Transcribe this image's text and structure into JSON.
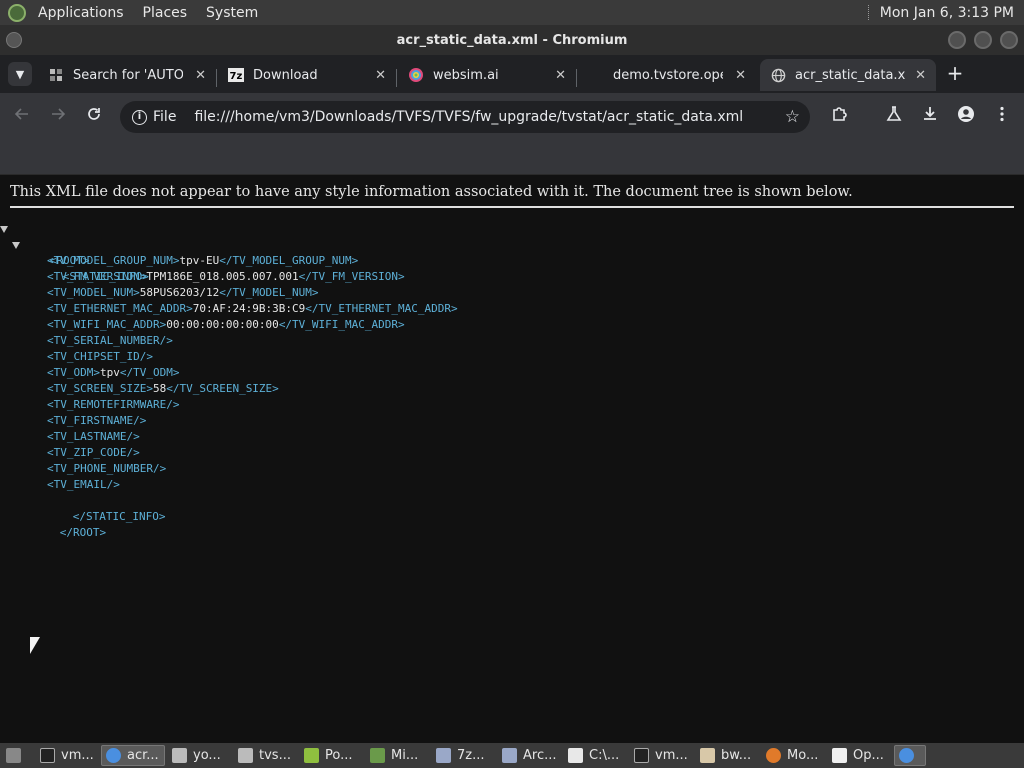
{
  "top_panel": {
    "menus": [
      "Applications",
      "Places",
      "System"
    ],
    "clock": "Mon Jan  6,  3:13 PM"
  },
  "window": {
    "title": "acr_static_data.xml - Chromium"
  },
  "tabs": [
    {
      "title": "Search for 'AUTOP",
      "icon": "search-tab-icon",
      "active": false
    },
    {
      "title": "Download",
      "icon": "7zip-icon",
      "active": false
    },
    {
      "title": "websim.ai",
      "icon": "websim-icon",
      "active": false
    },
    {
      "title": "demo.tvstore.oper",
      "icon": "blank-page-icon",
      "active": false
    },
    {
      "title": "acr_static_data.xm",
      "icon": "globe-icon",
      "active": true
    }
  ],
  "toolbar": {
    "site_info_label": "File",
    "url": "file:///home/vm3/Downloads/TVFS/TVFS/fw_upgrade/tvstat/acr_static_data.xml"
  },
  "content": {
    "notice": "This XML file does not appear to have any style information associated with it. The document tree is shown below.",
    "root_open": "<ROOT>",
    "static_open": "<STATIC_INFO>",
    "static_close": "</STATIC_INFO>",
    "root_close": "</ROOT>",
    "elements": [
      {
        "open": "<TV_MODEL_GROUP_NUM>",
        "value": "tpv-EU",
        "close": "</TV_MODEL_GROUP_NUM>"
      },
      {
        "open": "<TV_FM_VERSION>",
        "value": "TPM186E_018.005.007.001",
        "close": "</TV_FM_VERSION>"
      },
      {
        "open": "<TV_MODEL_NUM>",
        "value": "58PUS6203/12",
        "close": "</TV_MODEL_NUM>"
      },
      {
        "open": "<TV_ETHERNET_MAC_ADDR>",
        "value": "70:AF:24:9B:3B:C9",
        "close": "</TV_ETHERNET_MAC_ADDR>"
      },
      {
        "open": "<TV_WIFI_MAC_ADDR>",
        "value": "00:00:00:00:00:00",
        "close": "</TV_WIFI_MAC_ADDR>"
      },
      {
        "open": "<TV_SERIAL_NUMBER/>",
        "value": "",
        "close": ""
      },
      {
        "open": "<TV_CHIPSET_ID/>",
        "value": "",
        "close": ""
      },
      {
        "open": "<TV_ODM>",
        "value": "tpv",
        "close": "</TV_ODM>"
      },
      {
        "open": "<TV_SCREEN_SIZE>",
        "value": "58",
        "close": "</TV_SCREEN_SIZE>"
      },
      {
        "open": "<TV_REMOTEFIRMWARE/>",
        "value": "",
        "close": ""
      },
      {
        "open": "<TV_FIRSTNAME/>",
        "value": "",
        "close": ""
      },
      {
        "open": "<TV_LASTNAME/>",
        "value": "",
        "close": ""
      },
      {
        "open": "<TV_ZIP_CODE/>",
        "value": "",
        "close": ""
      },
      {
        "open": "<TV_PHONE_NUMBER/>",
        "value": "",
        "close": ""
      },
      {
        "open": "<TV_EMAIL/>",
        "value": "",
        "close": ""
      }
    ]
  },
  "taskbar": [
    {
      "label": "vm...",
      "icon": "terminal-icon",
      "active": false
    },
    {
      "label": "acr...",
      "icon": "chromium-icon",
      "active": true
    },
    {
      "label": "yo...",
      "icon": "folder-icon",
      "active": false
    },
    {
      "label": "tvs...",
      "icon": "folder-icon",
      "active": false
    },
    {
      "label": "Po...",
      "icon": "app-icon",
      "active": false
    },
    {
      "label": "Mi...",
      "icon": "package-icon",
      "active": false
    },
    {
      "label": "7z...",
      "icon": "network-icon",
      "active": false
    },
    {
      "label": "Arc...",
      "icon": "network-icon",
      "active": false
    },
    {
      "label": "C:\\...",
      "icon": "7zip-icon",
      "active": false
    },
    {
      "label": "vm...",
      "icon": "terminal-icon",
      "active": false
    },
    {
      "label": "bw...",
      "icon": "editor-icon",
      "active": false
    },
    {
      "label": "Mo...",
      "icon": "firefox-icon",
      "active": false
    },
    {
      "label": "Op...",
      "icon": "document-icon",
      "active": false
    },
    {
      "label": "",
      "icon": "chromium-icon",
      "active": true
    }
  ],
  "colors": {
    "panel": "#3a3a3a",
    "tabstrip": "#202124",
    "toolbar": "#35363a",
    "content_bg": "#111111",
    "xml_tag": "#5db0d7"
  }
}
